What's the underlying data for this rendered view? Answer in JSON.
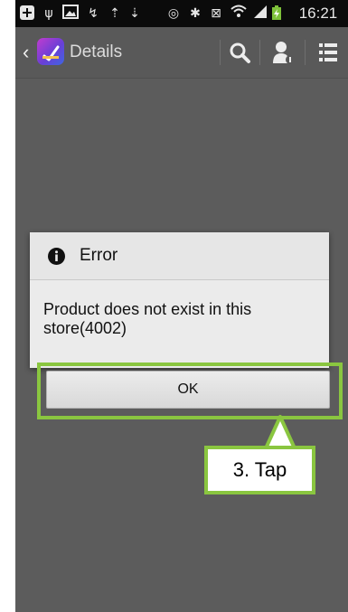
{
  "status_bar": {
    "time": "16:21",
    "icons": [
      "notification-plus-icon",
      "usb-icon",
      "image-icon",
      "call-forward-icon",
      "upload-icon",
      "download-icon",
      "eye-icon",
      "bluetooth-icon",
      "mute-icon",
      "wifi-icon",
      "signal-icon",
      "battery-charging-icon"
    ]
  },
  "action_bar": {
    "title": "Details",
    "actions": [
      "search-icon",
      "account-icon",
      "menu-list-icon"
    ]
  },
  "dialog": {
    "title": "Error",
    "message": "Product does not exist in this store(4002)",
    "ok_label": "OK"
  },
  "annotation": {
    "label": "3. Tap",
    "color": "#8ac640"
  },
  "colors": {
    "overlay": "#5c5c5c",
    "status_bar": "#0b0b0b",
    "dialog_bg": "#ebebeb"
  }
}
